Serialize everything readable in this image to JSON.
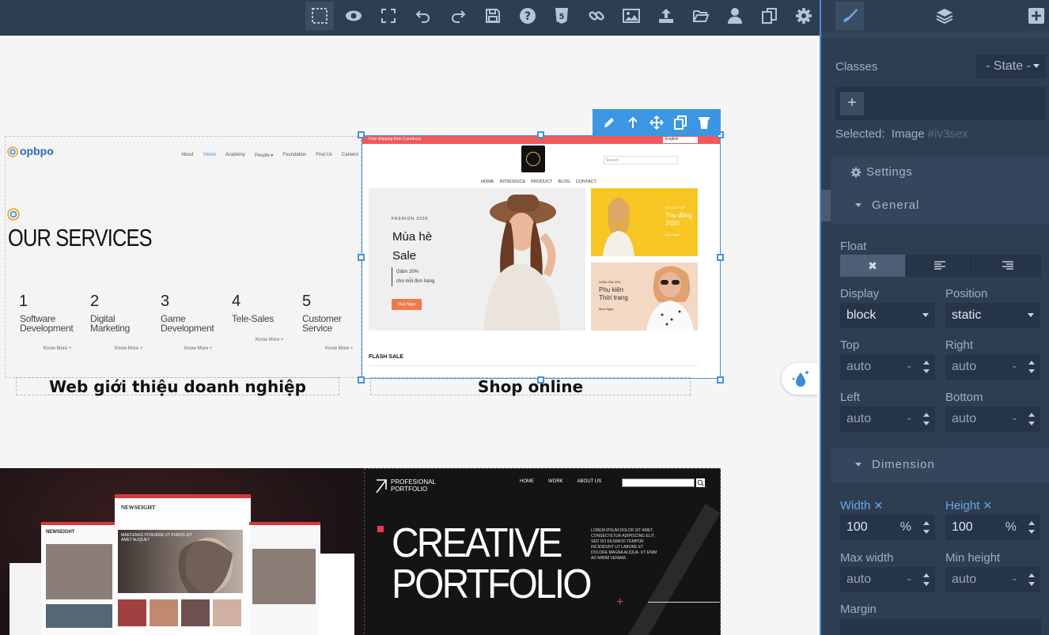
{
  "toolbar": {
    "buttons": [
      {
        "icon": "select-icon",
        "active": true
      },
      {
        "icon": "eye-icon"
      },
      {
        "icon": "fullscreen-icon"
      },
      {
        "icon": "undo-icon"
      },
      {
        "icon": "redo-icon"
      },
      {
        "icon": "save-icon"
      },
      {
        "icon": "help-icon"
      },
      {
        "icon": "html5-icon"
      },
      {
        "icon": "link-icon"
      },
      {
        "icon": "image-icon"
      },
      {
        "icon": "upload-icon"
      },
      {
        "icon": "folder-open-icon"
      },
      {
        "icon": "user-icon"
      },
      {
        "icon": "copy-icon"
      },
      {
        "icon": "gear-icon"
      }
    ]
  },
  "panel": {
    "tabs": [
      {
        "icon": "paintbrush-icon",
        "active": true
      },
      {
        "icon": "layers-icon"
      },
      {
        "icon": "plus-square-icon"
      }
    ],
    "classes_label": "Classes",
    "state_select": "- State -",
    "add_class": "+",
    "selected_label": "Selected:",
    "selected_name": "Image",
    "selected_id": "#iv3sex",
    "settings_title": "Settings",
    "general_title": "General",
    "float_label": "Float",
    "display_label": "Display",
    "display_value": "block",
    "position_label": "Position",
    "position_value": "static",
    "top_label": "Top",
    "top_value": "auto",
    "right_label": "Right",
    "right_value": "auto",
    "left_label": "Left",
    "left_value": "auto",
    "bottom_label": "Bottom",
    "bottom_value": "auto",
    "dash": "-",
    "dimension_title": "Dimension",
    "width_label": "Width",
    "width_value": "100",
    "width_unit": "%",
    "height_label": "Height",
    "height_value": "100",
    "height_unit": "%",
    "max_width_label": "Max width",
    "max_width_value": "auto",
    "min_height_label": "Min height",
    "min_height_value": "auto",
    "margin_label": "Margin"
  },
  "canvas": {
    "card1": {
      "caption": "Web giới thiệu doanh nghiệp",
      "logo": "opbpo",
      "nav": [
        "About",
        "Vision",
        "Academy",
        "People ▾",
        "Foundation",
        "Find Us",
        "Careers"
      ],
      "heading": "OUR SERVICES",
      "services": [
        {
          "num": "1",
          "line1": "Software",
          "line2": "Development",
          "more": "Know More +"
        },
        {
          "num": "2",
          "line1": "Digital",
          "line2": "Marketing",
          "more": "Know More +"
        },
        {
          "num": "3",
          "line1": "Game",
          "line2": "Development",
          "more": "Know More +"
        },
        {
          "num": "4",
          "line1": "Tele-Sales",
          "line2": "",
          "more": "Know More +"
        },
        {
          "num": "5",
          "line1": "Customer",
          "line2": "Service",
          "more": "Know More +"
        }
      ]
    },
    "card2": {
      "caption": "Shop online",
      "promo": "Free shipping from 5 products",
      "lang": "English",
      "search": "Search",
      "nav": [
        "HOME",
        "INTRODUCE",
        "PRODUCT",
        "BLOG",
        "CONTACT"
      ],
      "fashion": "FASHION 2020",
      "title1": "Mùa hè",
      "title2": "Sale",
      "discount1": "Giảm 20%",
      "discount2": "cho mỗi đơn hàng",
      "cta": "Mua Ngay",
      "side1_tag": "BỘ SƯU TẬP",
      "side1_title1": "Thu đông",
      "side1_title2": "2020",
      "side1_link": "Mua Ngay",
      "side2_tag": "GIẢM GIÁ 20%",
      "side2_title1": "Phụ kiện",
      "side2_title2": "Thời trang",
      "side2_link": "Mua Ngay",
      "flash": "FLASH SALE"
    },
    "card3": {
      "brand": "NEWSEIGHT",
      "headline": "MAECENAS POSUERE UT PURUS SIT AMET ALIQUET"
    },
    "card4": {
      "brand1": "PROFESIONAL",
      "brand2": "PORTFOLIO",
      "nav": [
        "HOME",
        "WORK",
        "ABOUT US"
      ],
      "title1": "CREATIVE",
      "title2": "PORTFOLIO",
      "lorem": "LOREM IPSUM DOLOR SIT AMET, CONSECTETUR ADIPISCING ELIT, SED DO EIUSMOD TEMPOR INCIDIDUNT UT LABORE ET DOLORE MAGNA ALIQUA. UT ENIM AD MINIM VENIAM."
    },
    "toolbar_icons": [
      "pencil-icon",
      "arrow-up-icon",
      "move-icon",
      "clone-icon",
      "trash-icon"
    ]
  },
  "colors": {
    "accent": "#4a90d9",
    "panel_bg": "#2e3e52",
    "shop_red": "#f05a5a",
    "shop_orange": "#f07a4a",
    "promo_yellow": "#f7c623"
  }
}
